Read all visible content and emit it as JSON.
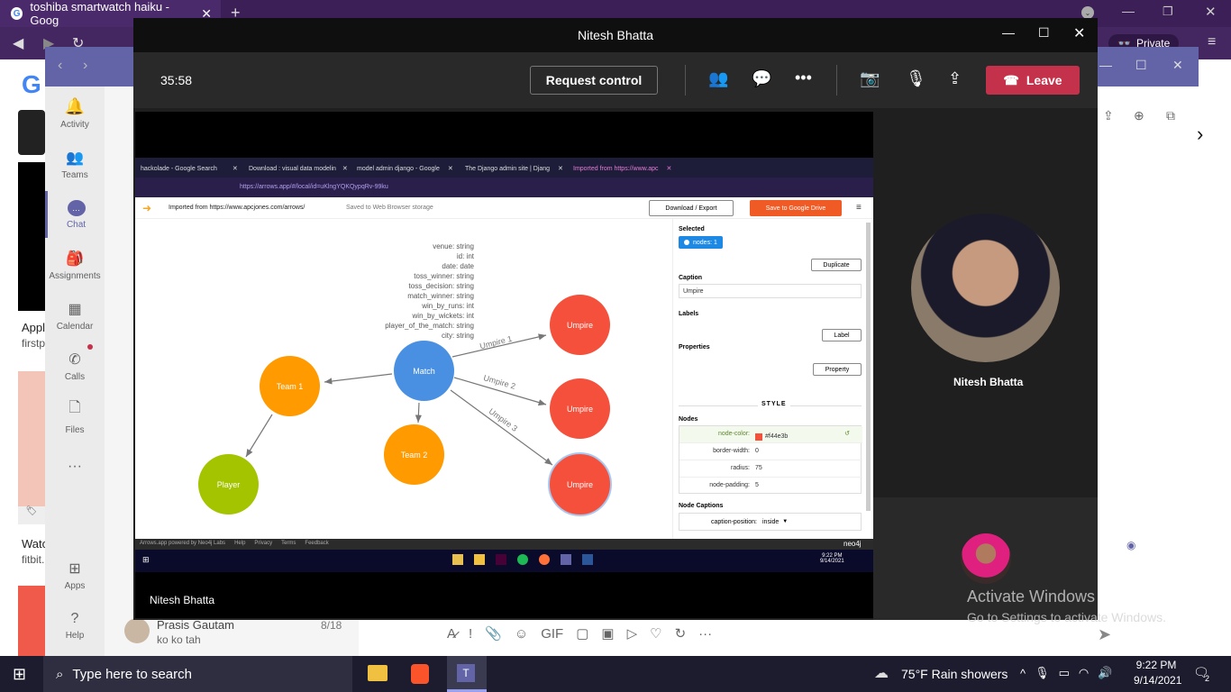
{
  "browser": {
    "tab_title": "toshiba smartwatch haiku - Goog",
    "private_label": "Private"
  },
  "teams": {
    "rail": [
      {
        "label": "Activity"
      },
      {
        "label": "Teams"
      },
      {
        "label": "Chat"
      },
      {
        "label": "Assignments"
      },
      {
        "label": "Calendar"
      },
      {
        "label": "Calls"
      },
      {
        "label": "Files"
      },
      {
        "label": "Apps"
      },
      {
        "label": "Help"
      }
    ],
    "chat_preview": {
      "name": "Prasis Gautam",
      "date": "8/18",
      "message": "ko ko tah"
    },
    "left_snippets": {
      "apple": "Appl",
      "firstp": "firstp",
      "watch": "Watc",
      "fitbit": "fitbit."
    }
  },
  "call": {
    "window_title": "Nitesh Bhatta",
    "timer": "35:58",
    "request_control": "Request control",
    "leave": "Leave",
    "presenter_name": "Nitesh Bhatta",
    "participant_name": "Nitesh Bhatta"
  },
  "shared": {
    "tabs": [
      "hackolade - Google Search",
      "Download : visual data modelin",
      "model admin django - Google",
      "The Django admin site | Djang",
      "Imported from https://www.apc"
    ],
    "url": "https://arrows.app/#/local/id=uKlngYQKQypqRv-99ku",
    "imported_from": "Imported from https://www.apcjones.com/arrows/",
    "saved_to": "Saved to Web Browser storage",
    "download_btn": "Download / Export",
    "save_drive": "Save to Google Drive",
    "properties_list": [
      "venue: string",
      "id: int",
      "date: date",
      "toss_winner: string",
      "toss_decision: string",
      "match_winner: string",
      "win_by_runs: int",
      "win_by_wickets: int",
      "player_of_the_match: string",
      "city: string"
    ],
    "nodes": {
      "match": "Match",
      "team1": "Team 1",
      "team2": "Team 2",
      "player": "Player",
      "umpire1": "Umpire",
      "umpire2": "Umpire",
      "umpire3": "Umpire"
    },
    "edges": {
      "e1": "Umpire 1",
      "e2": "Umpire 2",
      "e3": "Umpire 3"
    },
    "panel": {
      "selected": "Selected",
      "nodes_badge": "nodes:  1",
      "duplicate": "Duplicate",
      "caption_label": "Caption",
      "caption_value": "Umpire",
      "labels": "Labels",
      "add_label": "Label",
      "properties": "Properties",
      "add_property": "Property",
      "style": "STYLE",
      "nodes_section": "Nodes",
      "node_captions": "Node Captions",
      "style_rows": [
        {
          "k": "node-color:",
          "v": "#f44e3b"
        },
        {
          "k": "border-width:",
          "v": "0"
        },
        {
          "k": "radius:",
          "v": "75"
        },
        {
          "k": "node-padding:",
          "v": "5"
        }
      ],
      "caption_position_k": "caption-position:",
      "caption_position_v": "inside"
    },
    "footer": "Arrows.app powered by Neo4j Labs",
    "footer_links": [
      "Help",
      "Privacy",
      "Terms",
      "Feedback"
    ],
    "neo4j": "neo4j",
    "inner_time": "9:22 PM",
    "inner_date": "9/14/2021"
  },
  "watermark": {
    "line1": "Activate Windows",
    "line2": "Go to Settings to activate Windows."
  },
  "taskbar": {
    "search_placeholder": "Type here to search",
    "weather": "75°F  Rain showers",
    "time": "9:22 PM",
    "date": "9/14/2021",
    "notif_count": "2"
  },
  "colors": {
    "teams_purple": "#6264a7",
    "leave_red": "#c4314b",
    "match_blue": "#4a90e2",
    "team_orange": "#ff9a00",
    "umpire_red": "#f4503b",
    "player_green": "#a4c400"
  }
}
